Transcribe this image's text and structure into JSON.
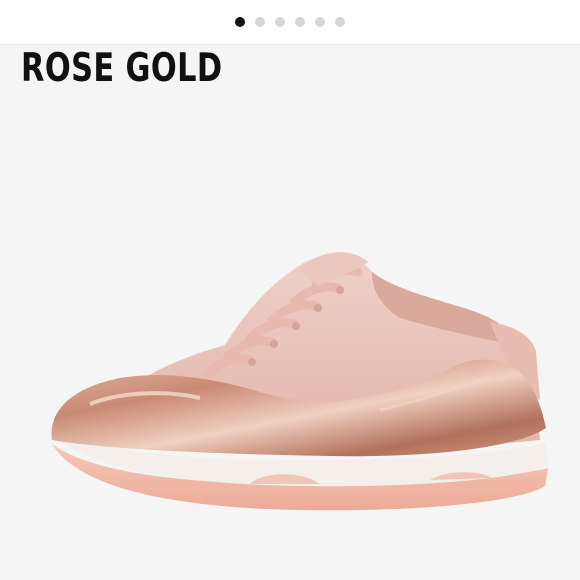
{
  "carousel": {
    "image_count": 6,
    "active_index": 0,
    "indicator_active_color": "#111111",
    "indicator_inactive_color": "#d6d6d6"
  },
  "banner": {
    "title": "ROSE GOLD"
  },
  "product_image": {
    "icon": "sneaker-image",
    "colors": {
      "background": "#f5f5f5",
      "suede": "#e9c2b8",
      "metallic": "#c98a74",
      "midsole": "#f4efea",
      "outsole": "#f2b9a8"
    }
  }
}
